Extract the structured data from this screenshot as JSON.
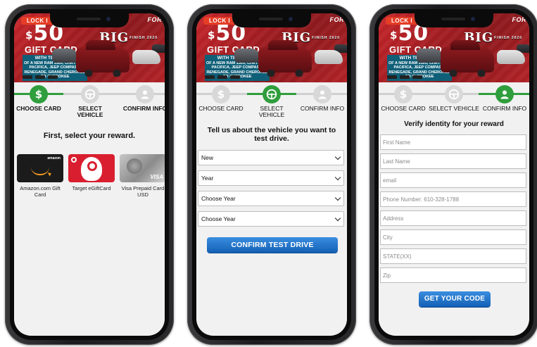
{
  "banner": {
    "lock_tag": "LOCK I",
    "dollar": "$",
    "amount": "50",
    "gift_card": "GIFT CARD",
    "test_drive_title": "WITH TEST DRIVE",
    "test_drive_text": "OF A NEW RAM 1500, CHRYSLER PACIFICA, JEEP COMPASS, RENEGADE, GRAND CHEROKEE OR CHEROKEE",
    "big_text": "BIG",
    "big_small": "FINISH 2020",
    "for_text": "FOR"
  },
  "steps": {
    "choose_card": "CHOOSE CARD",
    "select_vehicle_1": "SELECT",
    "select_vehicle_2": "VEHICLE",
    "select_vehicle_single": "SELECT VEHICLE",
    "confirm_info": "CONFIRM INFO",
    "confirm_info_truncated": "CONFIRM INFO"
  },
  "screen1": {
    "heading": "First, select your reward.",
    "cards": [
      {
        "caption": "Amazon.com Gift Card",
        "brand": "amazon"
      },
      {
        "caption": "Target eGiftCard",
        "brand": "target"
      },
      {
        "caption": "Visa Prepaid Card USD",
        "brand": "visa"
      }
    ]
  },
  "screen2": {
    "heading": "Tell us about the vehicle you want to test drive.",
    "selects": [
      "New",
      "Year",
      "Choose Year",
      "Choose Year"
    ],
    "cta": "CONFIRM TEST DRIVE"
  },
  "screen3": {
    "heading": "Verify identity for your reward",
    "fields": [
      "First Name",
      "Last Name",
      "email",
      "Phone Number: 610-328-1788",
      "Address",
      "City",
      "STATE(XX)",
      "Zip"
    ],
    "cta": "GET YOUR CODE"
  },
  "colors": {
    "accent_green": "#2f9e3c",
    "cta_blue": "#1a6fc8",
    "banner_red": "#b42327"
  }
}
